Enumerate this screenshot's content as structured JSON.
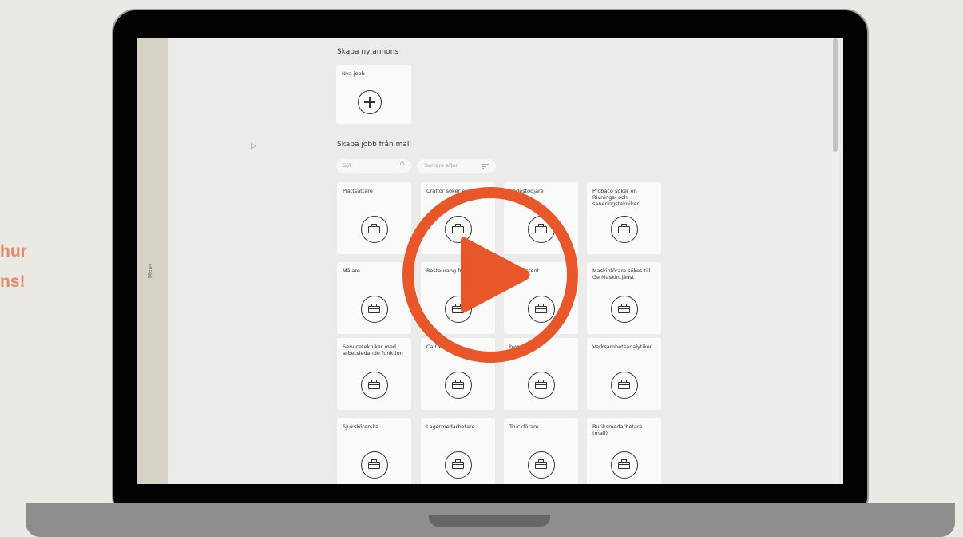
{
  "side_text": {
    "line1": "hur",
    "line2": "ns!"
  },
  "screen": {
    "menu_label": "Meny",
    "create_ad_title": "Skapa ny annons",
    "new_job_label": "Nya jobb",
    "template_title": "Skapa jobb från mall",
    "search_placeholder": "Sök",
    "sort_label": "Sortera efter",
    "cards": [
      "Plattsättare",
      "Craftor söker elkraft",
      "andestödjare",
      "Probaco söker en Rivnings- och saneringstekniker",
      "Målare",
      "Restaurang frågor",
      "ig assistent",
      "Maskinförare sökes till Ge Maskintjänst",
      "Servicetekniker med arbetsledande funktion",
      "Ca Demon",
      "bygg",
      "Verksamhetsanalytiker",
      "Sjuksköterska",
      "Lagermedarbetare",
      "Truckförare",
      "Butiksmedarbetare (mall)"
    ]
  },
  "icons": [
    "plus-icon",
    "briefcase-icon",
    "search-icon",
    "sort-icon",
    "play-icon",
    "cursor-icon"
  ],
  "colors": {
    "accent": "#e8572a",
    "side_text": "#e8866a",
    "menu_rail": "#d6d3c5"
  }
}
